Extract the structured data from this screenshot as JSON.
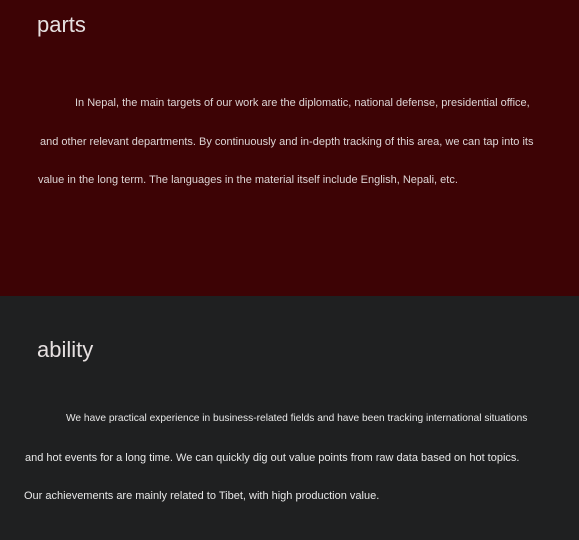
{
  "sections": {
    "parts": {
      "heading": "parts",
      "lines": [
        "In Nepal, the main targets of our work are the diplomatic, national defense, presidential office,",
        "and other relevant departments. By continuously and in-depth tracking of this area, we can tap into its",
        "value in the long term. The languages in the material itself include English, Nepali, etc."
      ]
    },
    "ability": {
      "heading": "ability",
      "lines": [
        "We have practical experience in business-related fields and have been tracking international situations",
        "and hot events for a long time. We can quickly dig out value points from raw data based on hot topics.",
        "Our achievements are mainly related to Tibet, with high production value."
      ]
    }
  },
  "colors": {
    "parts_background": "#3d0305",
    "ability_background": "#1f2021",
    "text": "#e6e0e0"
  }
}
